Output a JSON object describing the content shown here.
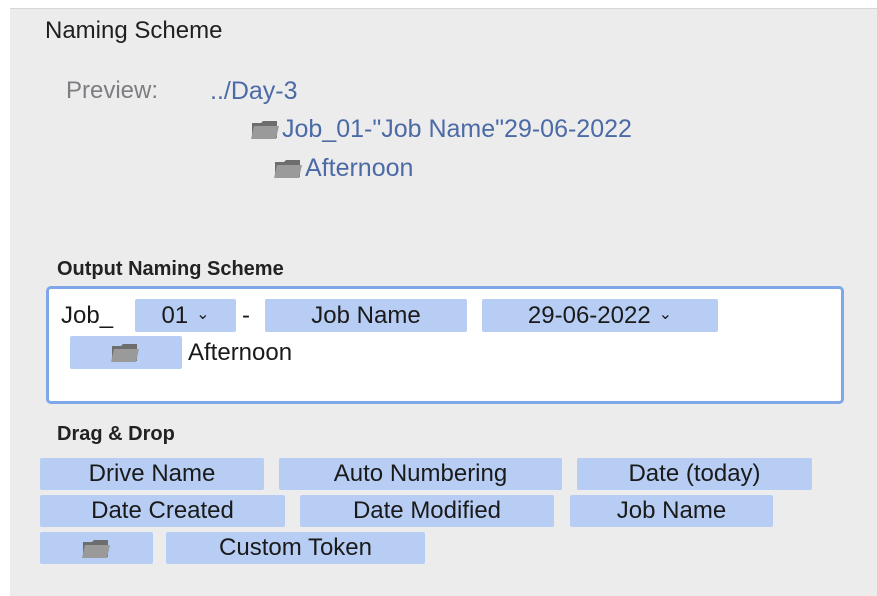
{
  "naming": {
    "title": "Naming Scheme",
    "preview_label": "Preview:",
    "preview_path": "../Day-3",
    "preview_folder1": "Job_01-\"Job Name\"29-06-2022",
    "preview_folder2": "Afternoon"
  },
  "output": {
    "title": "Output Naming Scheme",
    "prefix": "Job_",
    "number_value": "01",
    "separator": "-",
    "job_name": "Job Name",
    "date_value": "29-06-2022",
    "subfolder": "Afternoon"
  },
  "dragdrop": {
    "title": "Drag & Drop",
    "tokens": {
      "drive_name": "Drive Name",
      "auto_numbering": "Auto Numbering",
      "date_today": "Date (today)",
      "date_created": "Date Created",
      "date_modified": "Date Modified",
      "job_name": "Job Name",
      "custom_token": "Custom Token"
    }
  },
  "colors": {
    "token_bg": "#b7cdf3",
    "path_text": "#4b6aa6",
    "focus_ring": "#7da7e8"
  },
  "icons": {
    "folder": "folder-icon",
    "dropdown": "chevron-down-icon"
  }
}
